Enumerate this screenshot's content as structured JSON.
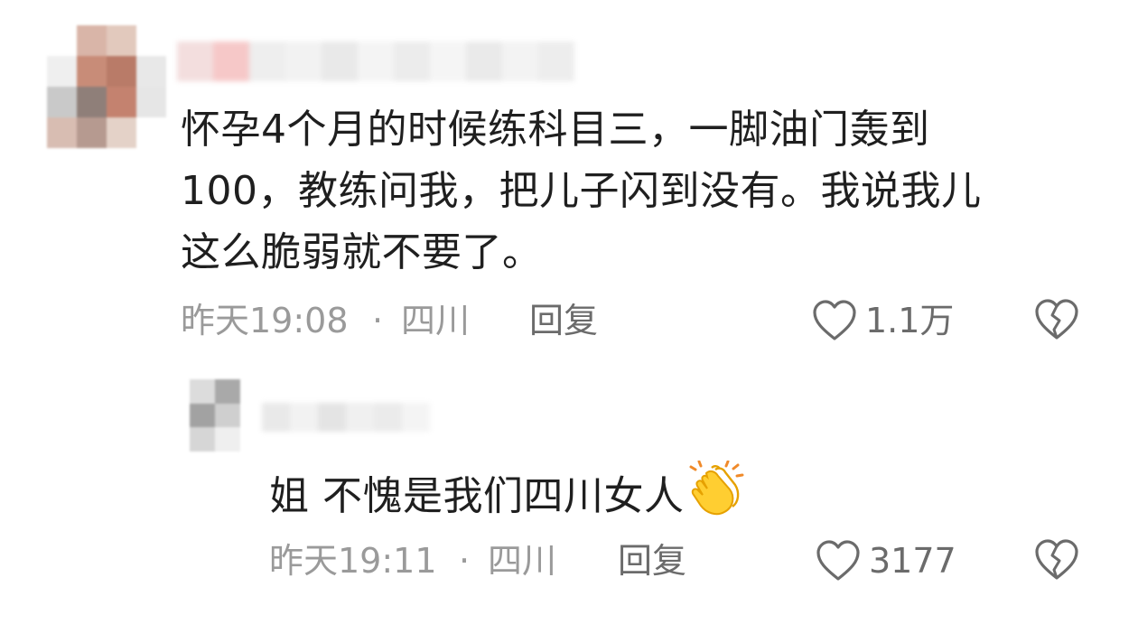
{
  "comments": [
    {
      "text_lines": [
        "怀孕4个月的时候练科目三，一脚油门轰到",
        "100，教练问我，把儿子闪到没有。我说我儿",
        "这么脆弱就不要了。"
      ],
      "time": "昨天19:08",
      "separator": "·",
      "location": "四川",
      "reply_label": "回复",
      "likes": "1.1万"
    },
    {
      "text": "姐 不愧是我们四川女人",
      "emoji": "clapping-hands-emoji",
      "time": "昨天19:11",
      "separator": "·",
      "location": "四川",
      "reply_label": "回复",
      "likes": "3177"
    }
  ],
  "icons": {
    "like": "heart-outline-icon",
    "dislike": "broken-heart-icon"
  },
  "colors": {
    "text": "#1f1f1f",
    "meta": "#9a9a9a",
    "action": "#6b6b6b",
    "background": "#ffffff"
  }
}
